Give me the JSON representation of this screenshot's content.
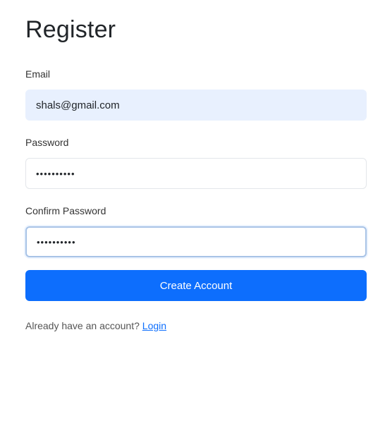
{
  "page": {
    "title": "Register"
  },
  "form": {
    "email": {
      "label": "Email",
      "value": "shals@gmail.com"
    },
    "password": {
      "label": "Password",
      "value": "••••••••••"
    },
    "confirm_password": {
      "label": "Confirm Password",
      "value": "••••••••••"
    },
    "submit_label": "Create Account"
  },
  "footer": {
    "prompt": "Already have an account?",
    "login_link": "Login"
  },
  "colors": {
    "primary": "#0d6efd",
    "autofill_bg": "#e8f0fe",
    "focus_border": "#a8c3e6"
  }
}
